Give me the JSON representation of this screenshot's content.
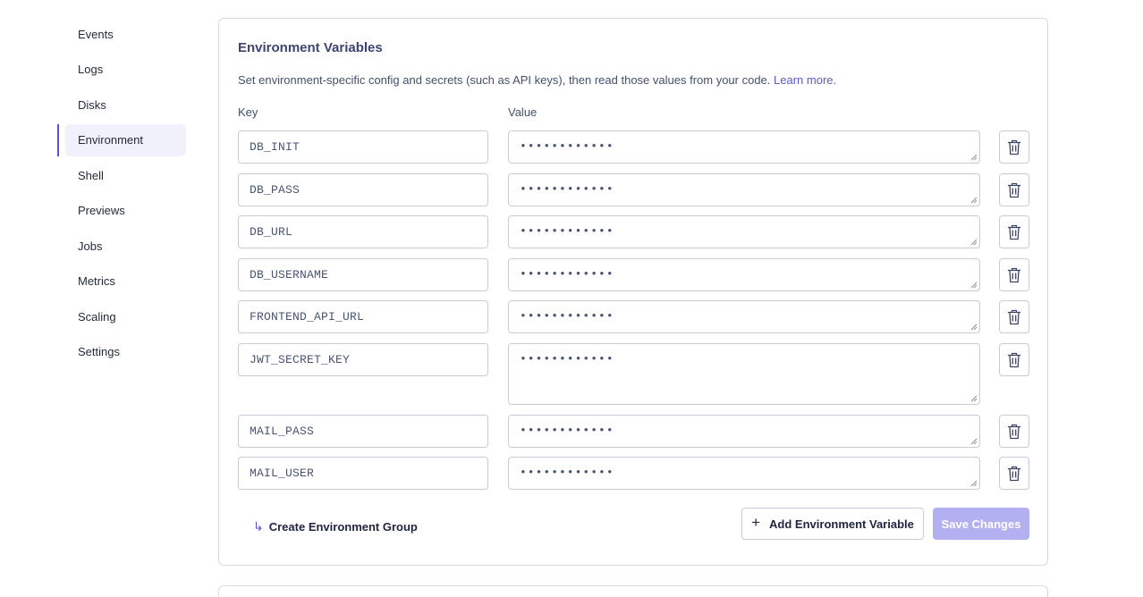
{
  "sidebar": {
    "items": [
      {
        "label": "Events",
        "active": false
      },
      {
        "label": "Logs",
        "active": false
      },
      {
        "label": "Disks",
        "active": false
      },
      {
        "label": "Environment",
        "active": true
      },
      {
        "label": "Shell",
        "active": false
      },
      {
        "label": "Previews",
        "active": false
      },
      {
        "label": "Jobs",
        "active": false
      },
      {
        "label": "Metrics",
        "active": false
      },
      {
        "label": "Scaling",
        "active": false
      },
      {
        "label": "Settings",
        "active": false
      }
    ]
  },
  "env": {
    "title": "Environment Variables",
    "description": "Set environment-specific config and secrets (such as API keys), then read those values from your code.",
    "learn_more": "Learn more.",
    "key_label": "Key",
    "value_label": "Value",
    "masked_value": "••••••••••••",
    "variables": [
      {
        "key": "DB_INIT"
      },
      {
        "key": "DB_PASS"
      },
      {
        "key": "DB_URL"
      },
      {
        "key": "DB_USERNAME"
      },
      {
        "key": "FRONTEND_API_URL"
      },
      {
        "key": "JWT_SECRET_KEY"
      },
      {
        "key": "MAIL_PASS"
      },
      {
        "key": "MAIL_USER"
      }
    ],
    "create_group_label": "Create Environment Group",
    "add_label": "Add Environment Variable",
    "save_label": "Save Changes"
  },
  "colors": {
    "accent": "#5b50d6",
    "link": "#5a57c9",
    "save_disabled": "#b3b0f2",
    "active_nav_bg": "#f0f1fb"
  },
  "icons": {
    "delete": "trash-icon",
    "add": "plus-icon",
    "create_group": "arrow-return-icon"
  }
}
